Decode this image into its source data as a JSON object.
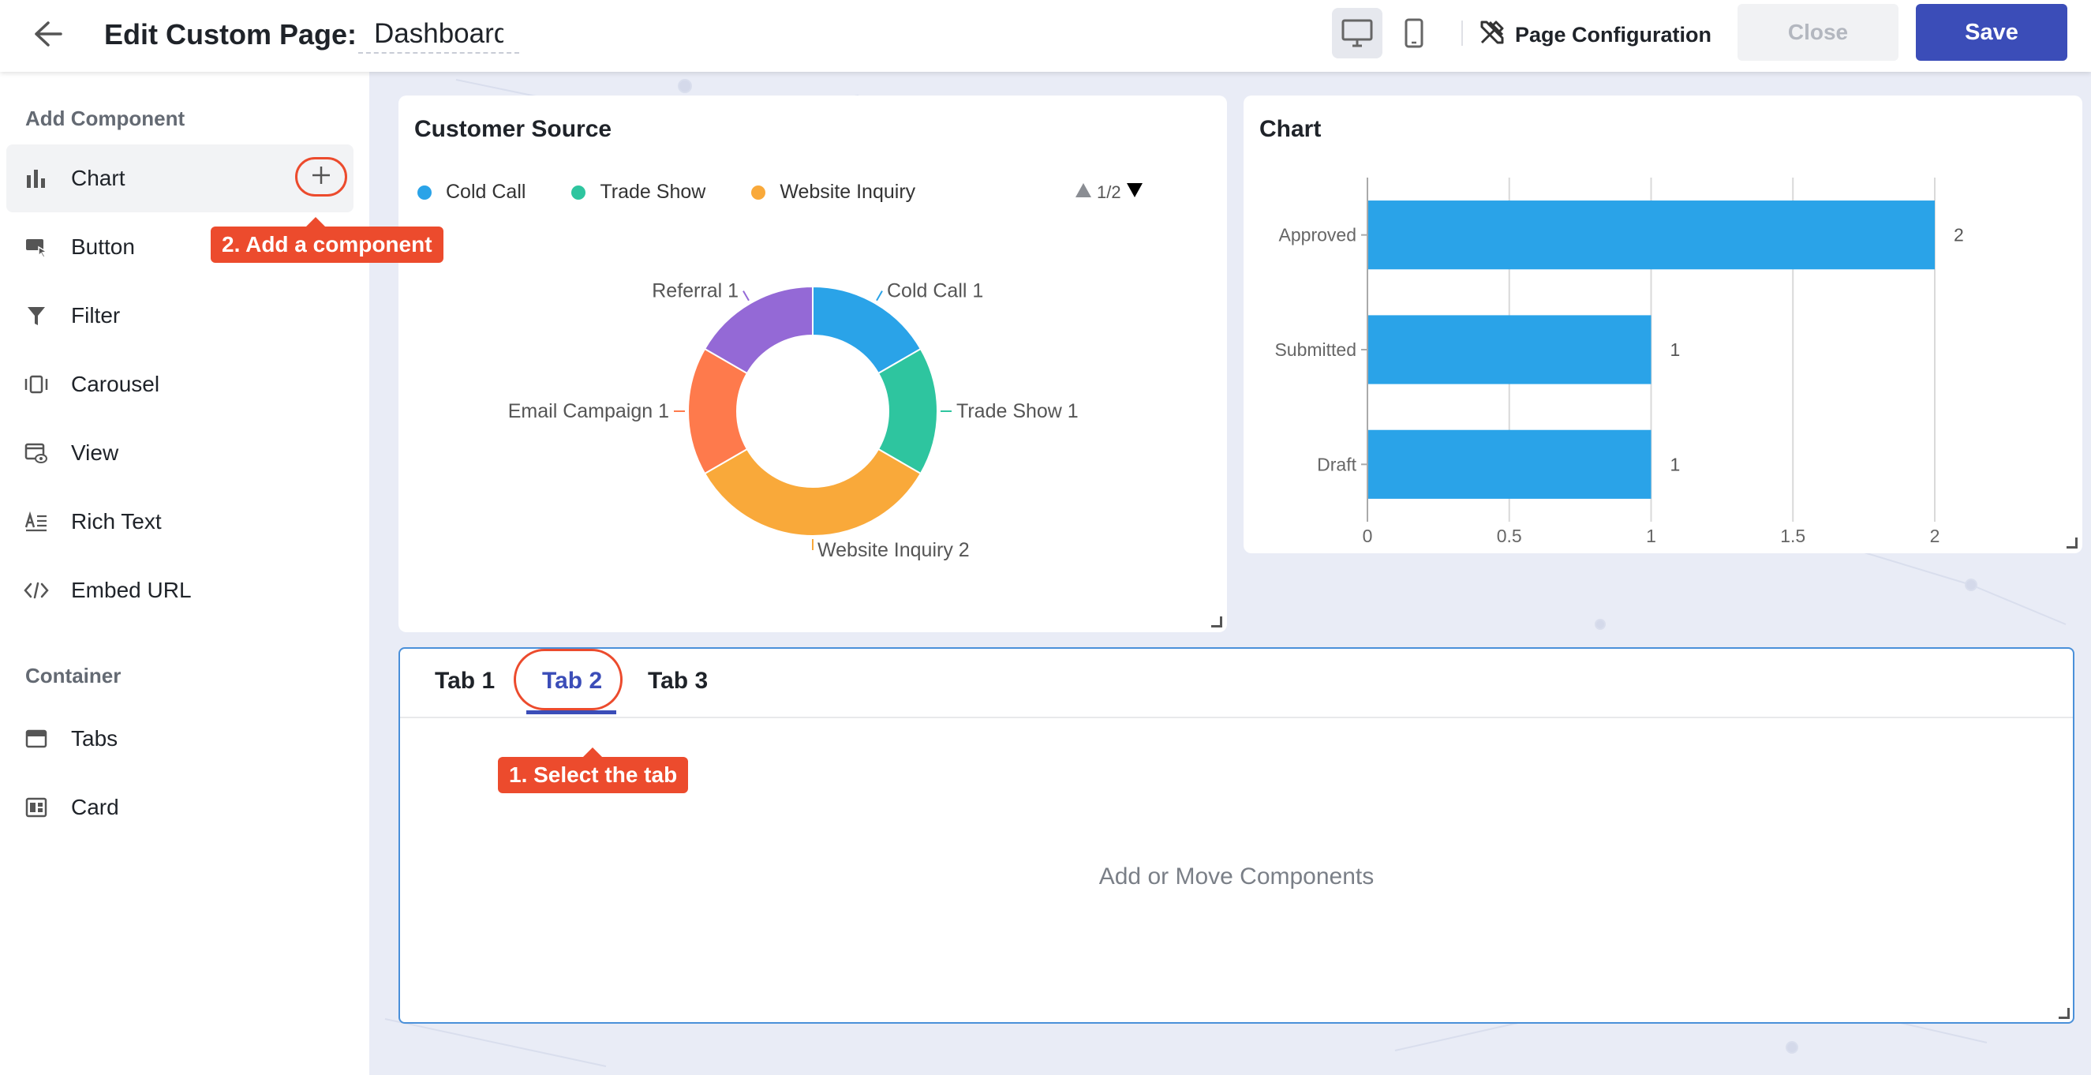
{
  "header": {
    "title_label": "Edit Custom Page:",
    "page_name": "Dashboard",
    "page_config_label": "Page Configuration",
    "close_label": "Close",
    "save_label": "Save",
    "active_device": "desktop"
  },
  "sidebar": {
    "add_component_title": "Add Component",
    "components": [
      {
        "label": "Chart",
        "icon": "bar-chart-icon"
      },
      {
        "label": "Button",
        "icon": "button-cursor-icon"
      },
      {
        "label": "Filter",
        "icon": "filter-funnel-icon"
      },
      {
        "label": "Carousel",
        "icon": "carousel-icon"
      },
      {
        "label": "View",
        "icon": "view-icon"
      },
      {
        "label": "Rich Text",
        "icon": "rich-text-icon"
      },
      {
        "label": "Embed URL",
        "icon": "code-icon"
      }
    ],
    "container_title": "Container",
    "containers": [
      {
        "label": "Tabs",
        "icon": "tabs-icon"
      },
      {
        "label": "Card",
        "icon": "card-icon"
      }
    ]
  },
  "tooltips": {
    "add_component": "2. Add a component",
    "select_tab": "1. Select the tab",
    "accent_color": "#ec4b2d"
  },
  "customer_source": {
    "title": "Customer Source",
    "legend_pager": "1/2"
  },
  "status_chart": {
    "title": "Chart"
  },
  "tabs_container": {
    "tabs": [
      "Tab 1",
      "Tab 2",
      "Tab 3"
    ],
    "active_tab": "Tab 2",
    "placeholder": "Add or Move Components"
  },
  "chart_data": [
    {
      "type": "pie",
      "title": "Customer Source",
      "donut": true,
      "legend_position": "top",
      "legend_visible": [
        "Cold Call",
        "Trade Show",
        "Website Inquiry"
      ],
      "slices": [
        {
          "label": "Cold Call",
          "value": 1,
          "color": "#2aa3e8"
        },
        {
          "label": "Trade Show",
          "value": 1,
          "color": "#2ec59f"
        },
        {
          "label": "Website Inquiry",
          "value": 2,
          "color": "#f9a93a"
        },
        {
          "label": "Email Campaign",
          "value": 1,
          "color": "#fe7a4c"
        },
        {
          "label": "Referral",
          "value": 1,
          "color": "#9469d6"
        }
      ]
    },
    {
      "type": "bar",
      "orientation": "horizontal",
      "title": "Chart",
      "categories": [
        "Approved",
        "Submitted",
        "Draft"
      ],
      "values": [
        2,
        1,
        1
      ],
      "xlim": [
        0,
        2
      ],
      "xticks": [
        "0",
        "0.5",
        "1",
        "1.5",
        "2"
      ],
      "color": "#2aa3e8",
      "grid": true
    }
  ]
}
